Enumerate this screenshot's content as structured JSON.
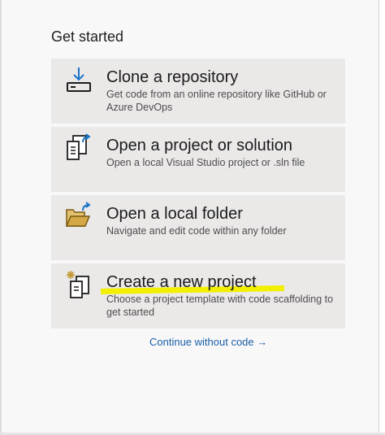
{
  "heading": "Get started",
  "cards": [
    {
      "title": "Clone a repository",
      "description": "Get code from an online repository like GitHub or Azure DevOps",
      "icon": "clone-download-icon"
    },
    {
      "title": "Open a project or solution",
      "description": "Open a local Visual Studio project or .sln file",
      "icon": "open-project-icon"
    },
    {
      "title": "Open a local folder",
      "description": "Navigate and edit code within any folder",
      "icon": "open-folder-icon"
    },
    {
      "title": "Create a new project",
      "description": "Choose a project template with code scaffolding to get started",
      "icon": "new-project-icon"
    }
  ],
  "continue_link": "Continue without code →",
  "colors": {
    "background": "#f9f8f9",
    "card_background": "#ebe8e8",
    "accent_blue": "#1a75c8",
    "link_blue": "#1a5fa8",
    "folder_gold": "#c39a3b",
    "annotation_highlight": "#f2f000"
  }
}
